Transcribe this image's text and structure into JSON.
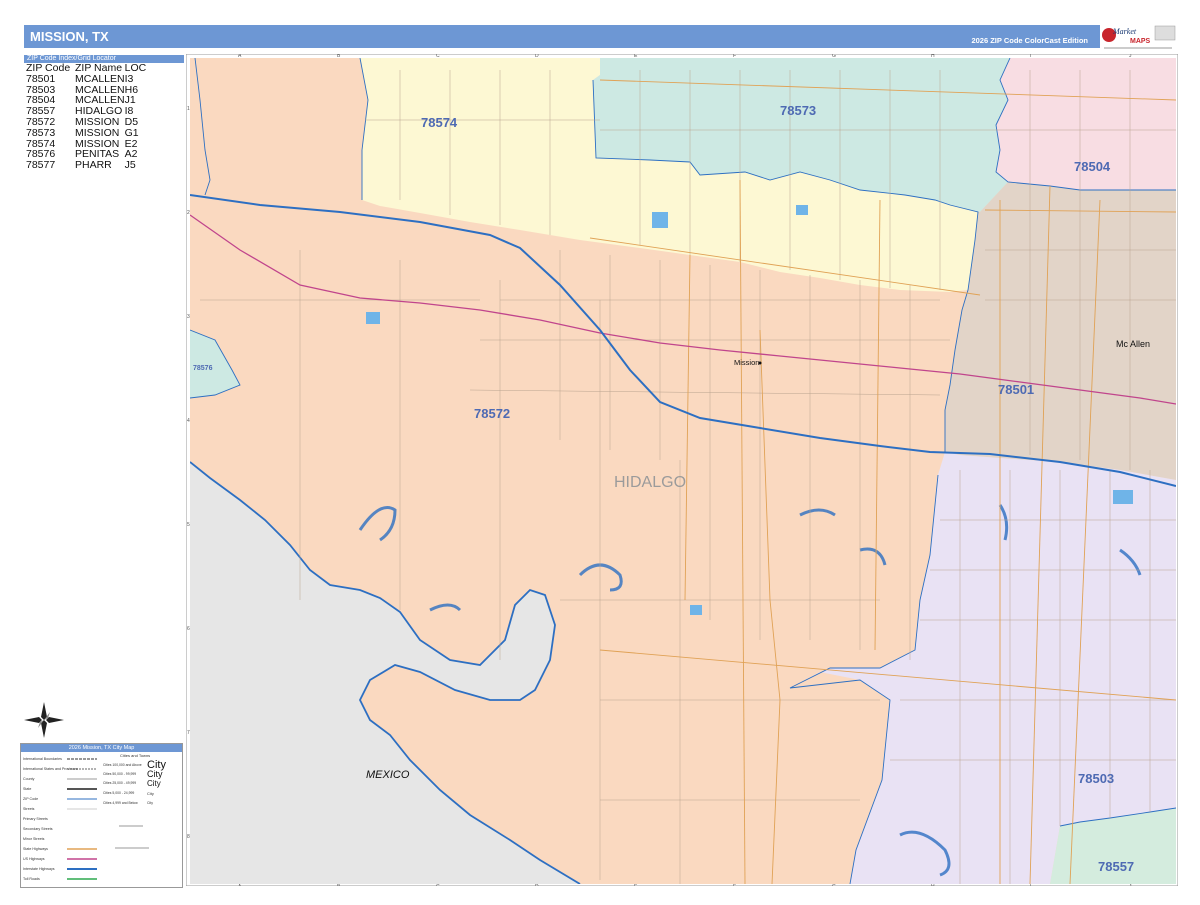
{
  "header": {
    "title": "MISSION, TX",
    "edition": "2026 ZIP Code ColorCast Edition"
  },
  "logo": {
    "brand_top": "Market",
    "brand_bottom": "MAPS"
  },
  "zip_index": {
    "title": "ZIP Code Index/Grid Locator",
    "columns": [
      "ZIP Code",
      "ZIP Name",
      "LOC"
    ],
    "rows": [
      [
        "78501",
        "MCALLEN",
        "I3"
      ],
      [
        "78503",
        "MCALLEN",
        "H6"
      ],
      [
        "78504",
        "MCALLEN",
        "J1"
      ],
      [
        "78557",
        "HIDALGO",
        "I8"
      ],
      [
        "78572",
        "MISSION",
        "D5"
      ],
      [
        "78573",
        "MISSION",
        "G1"
      ],
      [
        "78574",
        "MISSION",
        "E2"
      ],
      [
        "78576",
        "PENITAS",
        "A2"
      ],
      [
        "78577",
        "PHARR",
        "J5"
      ]
    ]
  },
  "map": {
    "zip_labels": {
      "z78574": "78574",
      "z78573": "78573",
      "z78504": "78504",
      "z78572": "78572",
      "z78501": "78501",
      "z78576": "78576",
      "z78503": "78503",
      "z78557": "78557"
    },
    "places": {
      "mission": "Mission",
      "mcallen": "Mc Allen",
      "county": "HIDALGO",
      "country": "MEXICO"
    },
    "grid_letters": [
      "A",
      "B",
      "C",
      "D",
      "E",
      "F",
      "G",
      "H",
      "I",
      "J"
    ],
    "grid_numbers": [
      "1",
      "2",
      "3",
      "4",
      "5",
      "6",
      "7",
      "8"
    ],
    "colors": {
      "z78572": "#fad9c0",
      "z78574": "#fdf8d3",
      "z78573": "#cde9e3",
      "z78504": "#f8dde3",
      "z78501": "#e2d4c8",
      "z78503": "#e9e2f4",
      "z78557": "#d4ecde",
      "mexico": "#e6e6e6",
      "river": "#2d6fc2",
      "highway": "#c0458c"
    }
  },
  "legend": {
    "title": "2026 Mission, TX City Map",
    "left_items": [
      "International Boundaries",
      "International States and Provinces",
      "County",
      "State",
      "ZIP Code",
      "Streets",
      "Primary Streets",
      "Secondary Streets",
      "Minor Streets",
      "State Highways",
      "US Highways",
      "Interstate Highways",
      "Toll Roads"
    ],
    "cities_heading": "Cities and Towns",
    "city_sizes": [
      "Cities 100,000 and Above",
      "Cities 50,000 - 99,999",
      "Cities 25,000 - 49,999",
      "Cities 5,000 - 24,999",
      "Cities 4,999 and Below"
    ],
    "city_word": "City"
  }
}
